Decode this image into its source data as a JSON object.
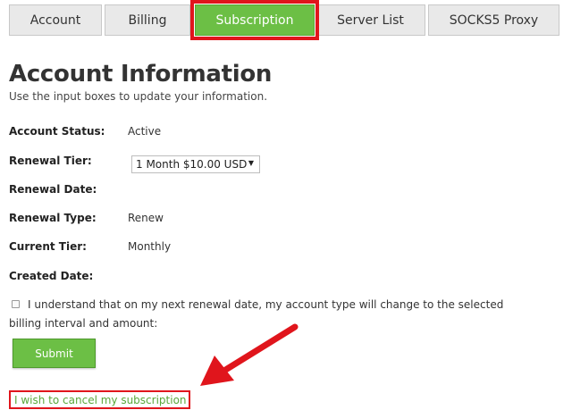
{
  "tabs": [
    {
      "label": "Account",
      "active": false
    },
    {
      "label": "Billing",
      "active": false
    },
    {
      "label": "Subscription",
      "active": true
    },
    {
      "label": "Server List",
      "active": false
    },
    {
      "label": "SOCKS5 Proxy",
      "active": false
    }
  ],
  "heading": "Account Information",
  "subtitle": "Use the input boxes to update your information.",
  "fields": {
    "account_status": {
      "label": "Account Status:",
      "value": "Active"
    },
    "renewal_tier": {
      "label": "Renewal Tier:",
      "value": "1 Month $10.00 USD"
    },
    "renewal_date": {
      "label": "Renewal Date:",
      "value": ""
    },
    "renewal_type": {
      "label": "Renewal Type:",
      "value": "Renew"
    },
    "current_tier": {
      "label": "Current Tier:",
      "value": "Monthly"
    },
    "created_date": {
      "label": "Created Date:",
      "value": ""
    }
  },
  "consent": {
    "line1": "I understand that on my next renewal date, my account type will change to the selected",
    "line2": "billing interval and amount:",
    "checked": false
  },
  "submit_label": "Submit",
  "cancel_link": "I wish to cancel my subscription",
  "colors": {
    "accent_green": "#6cbf45",
    "highlight_red": "#e0151c",
    "link_green": "#5aa83a",
    "tab_gray": "#e9e9e9"
  },
  "icons": {
    "dropdown": "caret-down-icon",
    "annotation": "red-arrow-icon"
  }
}
